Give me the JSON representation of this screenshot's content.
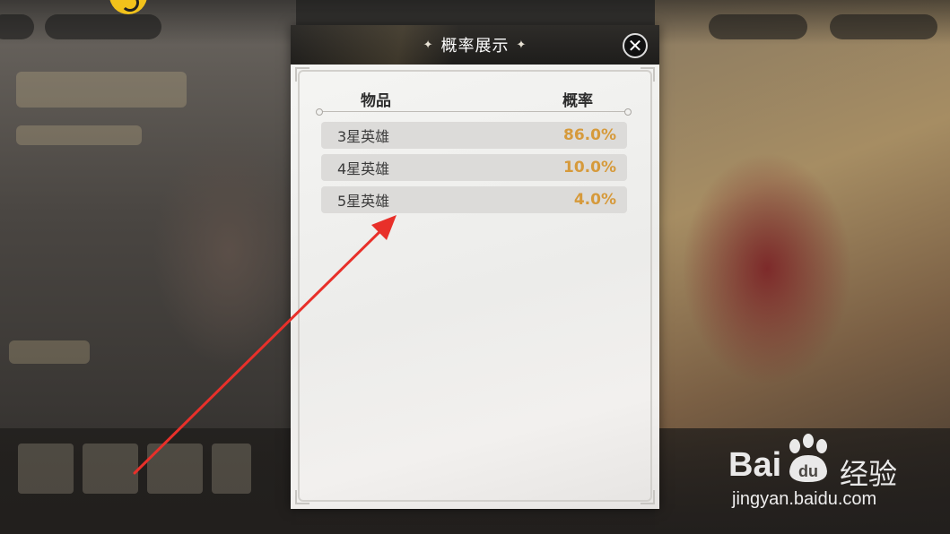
{
  "modal": {
    "title": "概率展示",
    "columns": {
      "item": "物品",
      "rate": "概率"
    },
    "rows": [
      {
        "name": "3星英雄",
        "rate": "86.0%"
      },
      {
        "name": "4星英雄",
        "rate": "10.0%"
      },
      {
        "name": "5星英雄",
        "rate": "4.0%"
      }
    ]
  },
  "watermark": {
    "bai": "Bai",
    "du": "du",
    "jingyan": "经验",
    "url": "jingyan.baidu.com"
  },
  "colors": {
    "header_bg": "#1e1d1b",
    "rate_text": "#d69a3b",
    "row_bg": "#dcdbd9",
    "arrow": "#e8302a"
  },
  "icons": {
    "close": "close-icon",
    "title_decor": "sparkle-star-icon",
    "coin": "coin-icon"
  }
}
